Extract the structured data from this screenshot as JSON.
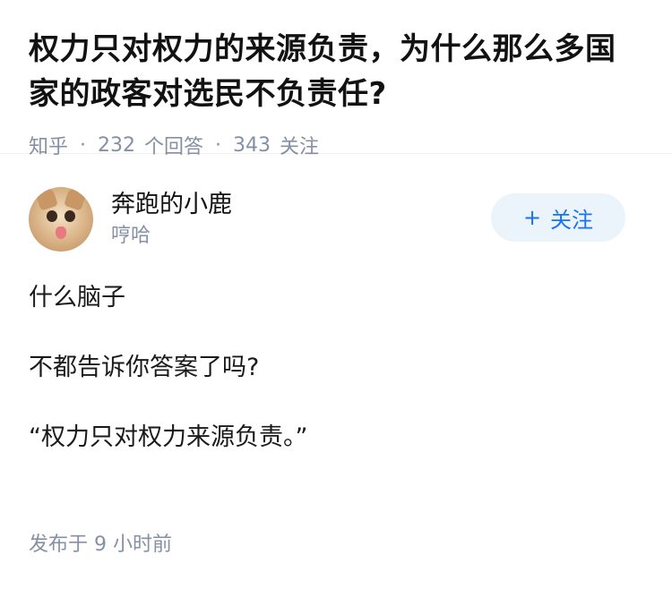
{
  "question": {
    "title": "权力只对权力的来源负责，为什么那么多国家的政客对选民不负责任?",
    "source": "知乎",
    "answer_count": "232",
    "answer_label": "个回答",
    "follow_count": "343",
    "follow_label": "关注"
  },
  "author": {
    "name": "奔跑的小鹿",
    "bio": "哼哈",
    "follow_button": "关注",
    "follow_icon": "plus-icon"
  },
  "answer": {
    "paragraphs": [
      "什么脑子",
      "不都告诉你答案了吗?",
      "“权力只对权力来源负责。”"
    ],
    "published_label": "发布于",
    "published_time": "9 小时前"
  },
  "colors": {
    "accent": "#1772f6",
    "muted": "#8590a6",
    "button_bg": "#ebf3fb"
  }
}
